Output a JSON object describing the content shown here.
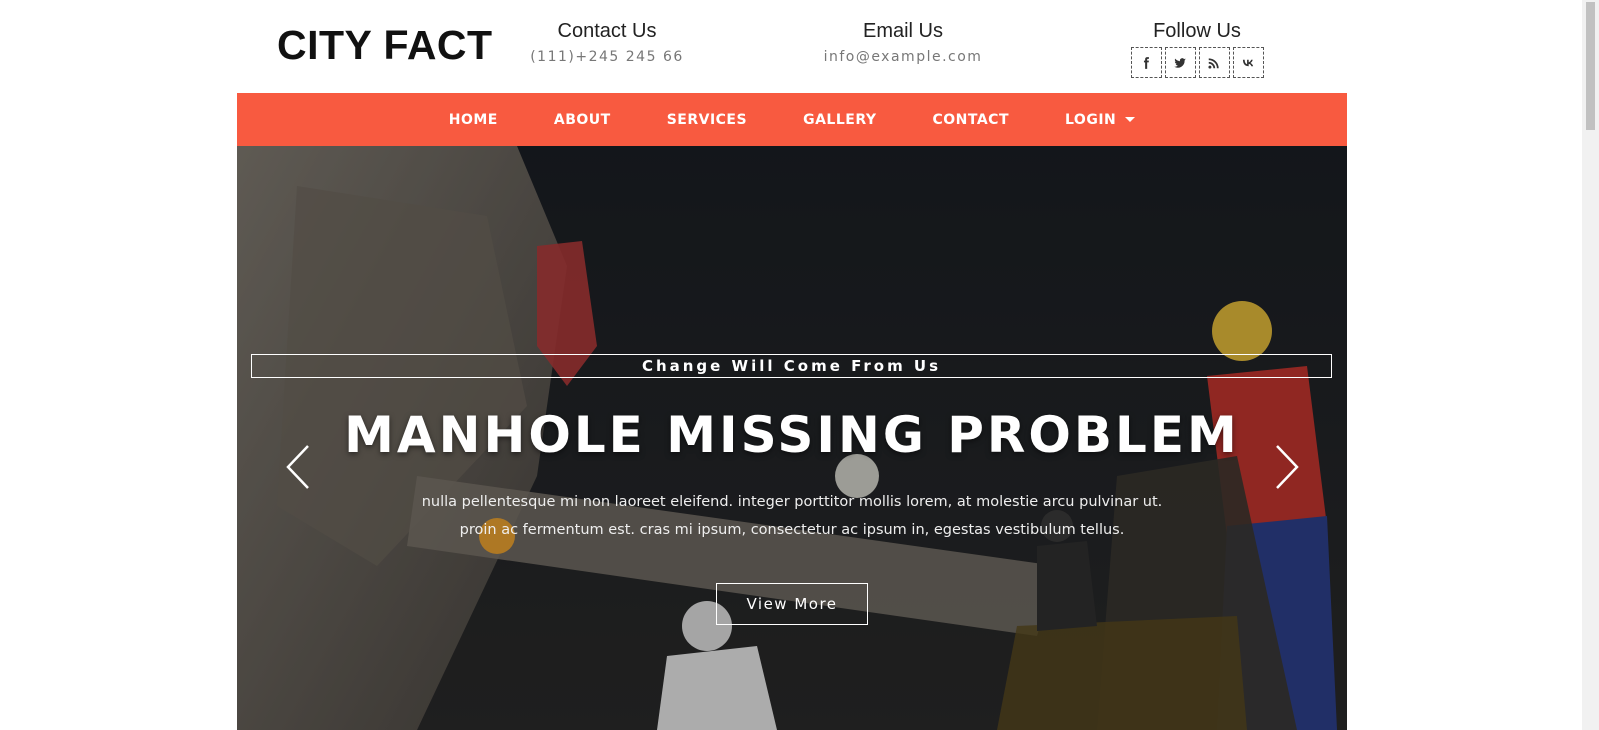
{
  "header": {
    "logo": "CITY FACT",
    "contact": {
      "title": "Contact Us",
      "value": "(111)+245 245 66"
    },
    "email": {
      "title": "Email Us",
      "value": "info@example.com"
    },
    "follow": {
      "title": "Follow Us",
      "icons": [
        "facebook-icon",
        "twitter-icon",
        "rss-icon",
        "vk-icon"
      ]
    }
  },
  "nav": {
    "items": [
      "HOME",
      "ABOUT",
      "SERVICES",
      "GALLERY",
      "CONTACT",
      "LOGIN"
    ],
    "accent": "#f85a40"
  },
  "hero": {
    "tagline": "Change Will Come From Us",
    "title": "MANHOLE MISSING PROBLEM",
    "text": "nulla pellentesque mi non laoreet eleifend. integer porttitor mollis lorem, at molestie arcu pulvinar ut. proin ac fermentum est. cras mi ipsum, consectetur ac ipsum in, egestas vestibulum tellus.",
    "button": "View More"
  }
}
